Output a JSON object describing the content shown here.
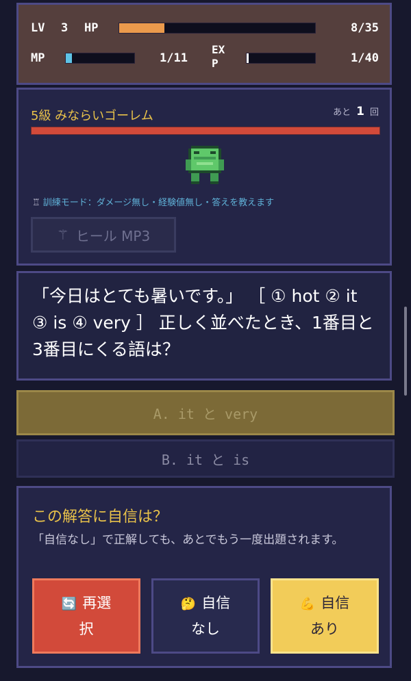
{
  "status": {
    "lv_label": "LV",
    "lv_value": "3",
    "hp_label": "HP",
    "hp_text": "8/35",
    "hp_fraction": 0.23,
    "mp_label": "MP",
    "mp_text": "1/11",
    "mp_fraction": 0.09,
    "exp_label_1": "EX",
    "exp_label_2": "P",
    "exp_text": "1/40",
    "exp_fraction": 0.025
  },
  "enemy": {
    "name": "5級 みならいゴーレム",
    "turns_prefix": "あと",
    "turns_value": "1",
    "turns_suffix": "回",
    "hp_fraction": 1.0,
    "icon": "golem-sprite",
    "training_icon": "tower-icon",
    "training_text": "訓練モード：ダメージ無し・経験値無し・答えを教えます",
    "heal_icon": "wand-icon",
    "heal_label": "ヒール MP3"
  },
  "question": {
    "text": "「今日はとても暑いです。」 ［ ① hot ② it ③ is ④ very ］ 正しく並べたとき、1番目と3番目にくる語は？"
  },
  "answers": [
    {
      "label": "A. it と very"
    },
    {
      "label": "B. it と is"
    }
  ],
  "confidence": {
    "title": "この解答に自信は？",
    "note": "「自信なし」で正解しても、あとでもう一度出題されます。",
    "buttons": [
      {
        "icon": "🔄",
        "line1": "再選",
        "line2": "択"
      },
      {
        "icon": "🤔",
        "line1": "自信",
        "line2": "なし"
      },
      {
        "icon": "💪",
        "line1": "自信",
        "line2": "あり"
      }
    ]
  },
  "colors": {
    "hp_fill": "#eb9a4c",
    "mp_fill": "#5ec3e6",
    "exp_fill": "#ffffff",
    "enemy_hp": "#d24a3a",
    "accent_yellow": "#e9c24a"
  }
}
